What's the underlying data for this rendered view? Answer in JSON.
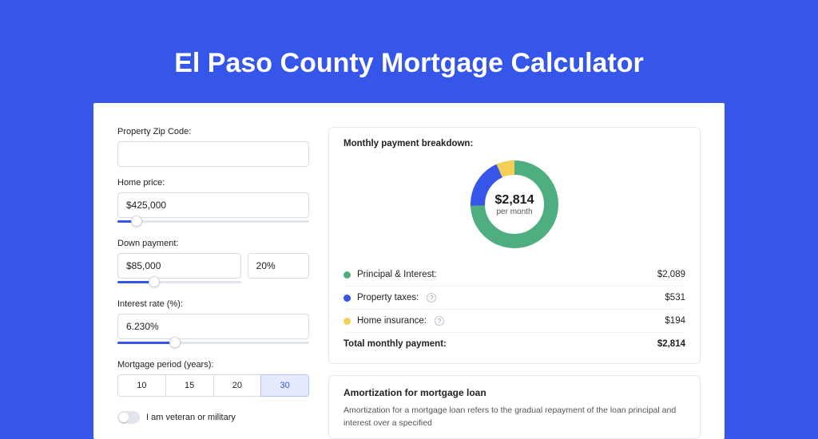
{
  "title": "El Paso County Mortgage Calculator",
  "colors": {
    "principal": "#4fae7f",
    "taxes": "#3556e8",
    "insurance": "#f3cf57"
  },
  "form": {
    "zip_label": "Property Zip Code:",
    "zip_value": "",
    "home_price_label": "Home price:",
    "home_price_value": "$425,000",
    "home_price_slider_pct": 10,
    "down_payment_label": "Down payment:",
    "down_payment_value": "$85,000",
    "down_payment_pct": "20%",
    "down_payment_slider_pct": 20,
    "interest_label": "Interest rate (%):",
    "interest_value": "6.230%",
    "interest_slider_pct": 30,
    "period_label": "Mortgage period (years):",
    "period_options": [
      "10",
      "15",
      "20",
      "30"
    ],
    "period_selected": "30",
    "veteran_label": "I am veteran or military"
  },
  "breakdown": {
    "title": "Monthly payment breakdown:",
    "total_amount": "$2,814",
    "total_sub": "per month",
    "items": [
      {
        "label": "Principal & Interest:",
        "amount": "$2,089",
        "color_key": "principal",
        "info": false
      },
      {
        "label": "Property taxes:",
        "amount": "$531",
        "color_key": "taxes",
        "info": true
      },
      {
        "label": "Home insurance:",
        "amount": "$194",
        "color_key": "insurance",
        "info": true
      }
    ],
    "total_label": "Total monthly payment:",
    "total_value": "$2,814"
  },
  "amortization": {
    "title": "Amortization for mortgage loan",
    "text": "Amortization for a mortgage loan refers to the gradual repayment of the loan principal and interest over a specified"
  },
  "chart_data": {
    "type": "pie",
    "title": "Monthly payment breakdown",
    "series": [
      {
        "name": "Principal & Interest",
        "value": 2089
      },
      {
        "name": "Property taxes",
        "value": 531
      },
      {
        "name": "Home insurance",
        "value": 194
      }
    ],
    "total": 2814,
    "unit": "USD per month"
  }
}
